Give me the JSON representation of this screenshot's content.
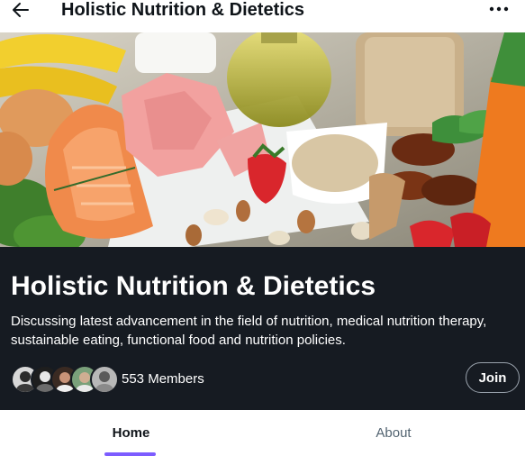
{
  "header": {
    "title": "Holistic Nutrition & Dietetics",
    "back_icon": "arrow-left-icon",
    "more_icon": "more-horizontal-icon"
  },
  "banner": {
    "image_subject": "healthy food assortment: salmon, chicken, eggs, fruit, nuts, oats, olive oil"
  },
  "group": {
    "name": "Holistic Nutrition & Dietetics",
    "description": "Discussing latest advancement in the field of nutrition, medical nutrition therapy, sustainable eating, functional food and nutrition policies.",
    "members_label": "553 Members",
    "join_label": "Join",
    "avatar_count": 5
  },
  "tabs": [
    {
      "label": "Home",
      "active": true
    },
    {
      "label": "About",
      "active": false
    }
  ],
  "colors": {
    "panel_bg": "#161b22",
    "accent": "#7c5cff",
    "text_primary": "#0f1419",
    "text_secondary": "#536471"
  }
}
